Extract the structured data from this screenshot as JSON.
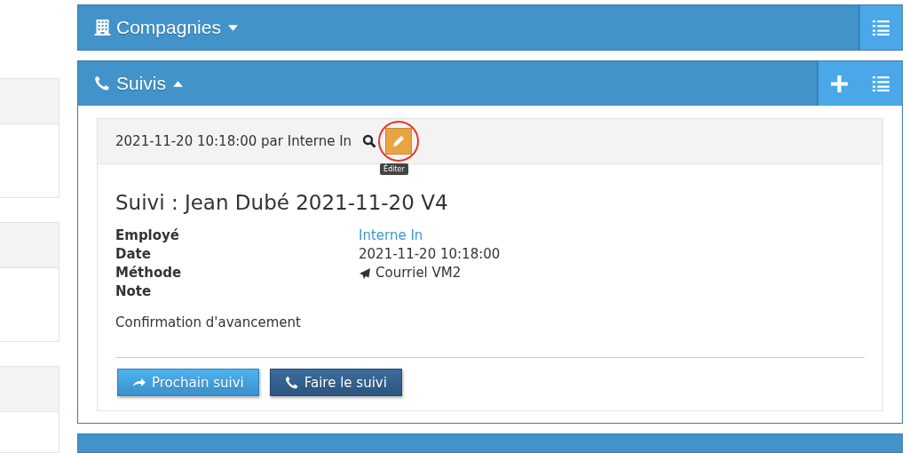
{
  "panels": [
    {
      "title": "Compagnies",
      "kind": "companies",
      "expanded": false,
      "actions": [
        {
          "kind": "list"
        }
      ]
    },
    {
      "title": "Suivis",
      "kind": "followups",
      "expanded": true,
      "actions": [
        {
          "kind": "add"
        },
        {
          "kind": "list"
        }
      ]
    }
  ],
  "followup": {
    "header": "2021-11-20 10:18:00 par Interne In",
    "tooltip": "Éditer",
    "highlighted": true,
    "title": "Suivi : Jean Dubé 2021-11-20 V4",
    "fields": [
      {
        "label": "Employé",
        "value": "Interne In",
        "kind": "link"
      },
      {
        "label": "Date",
        "value": "2021-11-20 10:18:00",
        "kind": "text"
      },
      {
        "label": "Méthode",
        "value": "Courriel VM2",
        "kind": "method"
      },
      {
        "label": "Note",
        "kind": "text"
      }
    ],
    "note": "Confirmation d'avancement",
    "buttons": [
      {
        "label": "Prochain suivi",
        "kind": "next"
      },
      {
        "label": "Faire le suivi",
        "kind": "call"
      }
    ]
  }
}
